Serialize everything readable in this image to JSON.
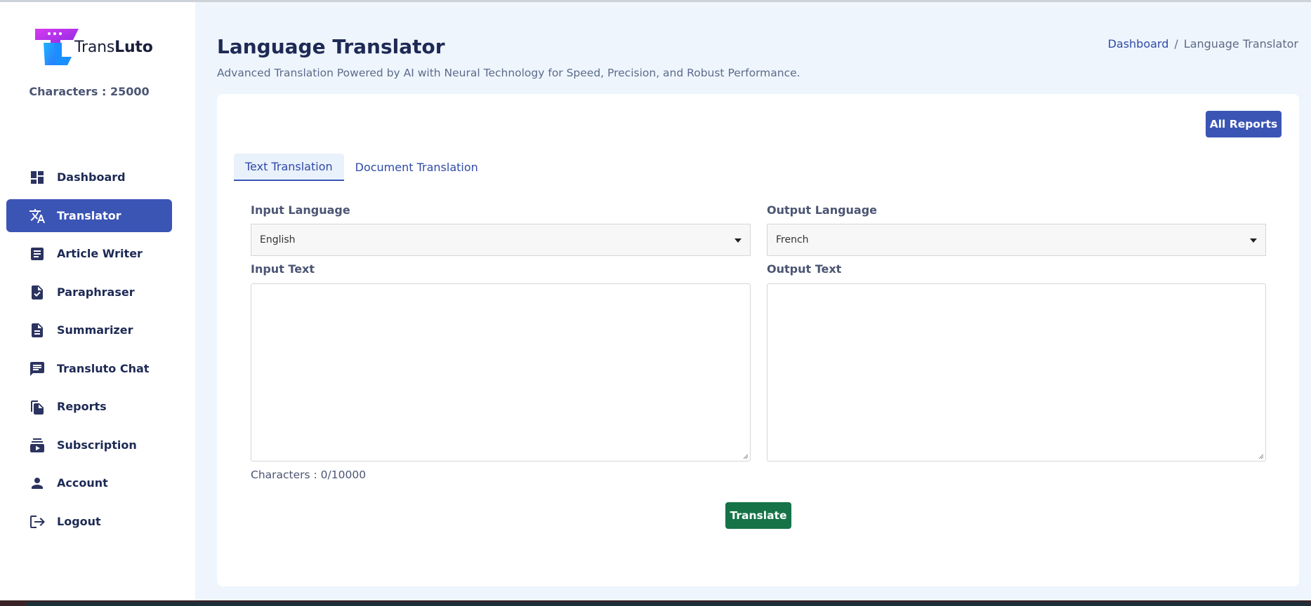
{
  "brand": {
    "name_light": "Trans",
    "name_bold": "Luto"
  },
  "sidebar": {
    "characters": "Characters : 25000",
    "items": [
      {
        "label": "Dashboard",
        "icon": "dashboard-icon",
        "active": false
      },
      {
        "label": "Translator",
        "icon": "translate-icon",
        "active": true
      },
      {
        "label": "Article Writer",
        "icon": "article-icon",
        "active": false
      },
      {
        "label": "Paraphraser",
        "icon": "document-check-icon",
        "active": false
      },
      {
        "label": "Summarizer",
        "icon": "document-lines-icon",
        "active": false
      },
      {
        "label": "Transluto Chat",
        "icon": "chat-icon",
        "active": false
      },
      {
        "label": "Reports",
        "icon": "reports-icon",
        "active": false
      },
      {
        "label": "Subscription",
        "icon": "subscription-icon",
        "active": false
      },
      {
        "label": "Account",
        "icon": "person-icon",
        "active": false
      },
      {
        "label": "Logout",
        "icon": "logout-icon",
        "active": false
      }
    ]
  },
  "header": {
    "title": "Language Translator",
    "subtitle": "Advanced Translation Powered by AI with Neural Technology for Speed, Precision, and Robust Performance.",
    "breadcrumb": {
      "home": "Dashboard",
      "separator": "/",
      "current": "Language Translator"
    }
  },
  "main": {
    "all_reports_label": "All Reports",
    "tabs": [
      {
        "label": "Text Translation",
        "active": true
      },
      {
        "label": "Document Translation",
        "active": false
      }
    ],
    "input_language_label": "Input Language",
    "input_language_value": "English",
    "output_language_label": "Output Language",
    "output_language_value": "French",
    "input_text_label": "Input Text",
    "input_text_value": "",
    "output_text_label": "Output Text",
    "output_text_value": "",
    "char_counter": "Characters : 0/10000",
    "translate_label": "Translate"
  },
  "colors": {
    "primary": "#3b55b5",
    "success": "#157347",
    "page_bg": "#eef5fd",
    "text_dark": "#1e2a55"
  }
}
